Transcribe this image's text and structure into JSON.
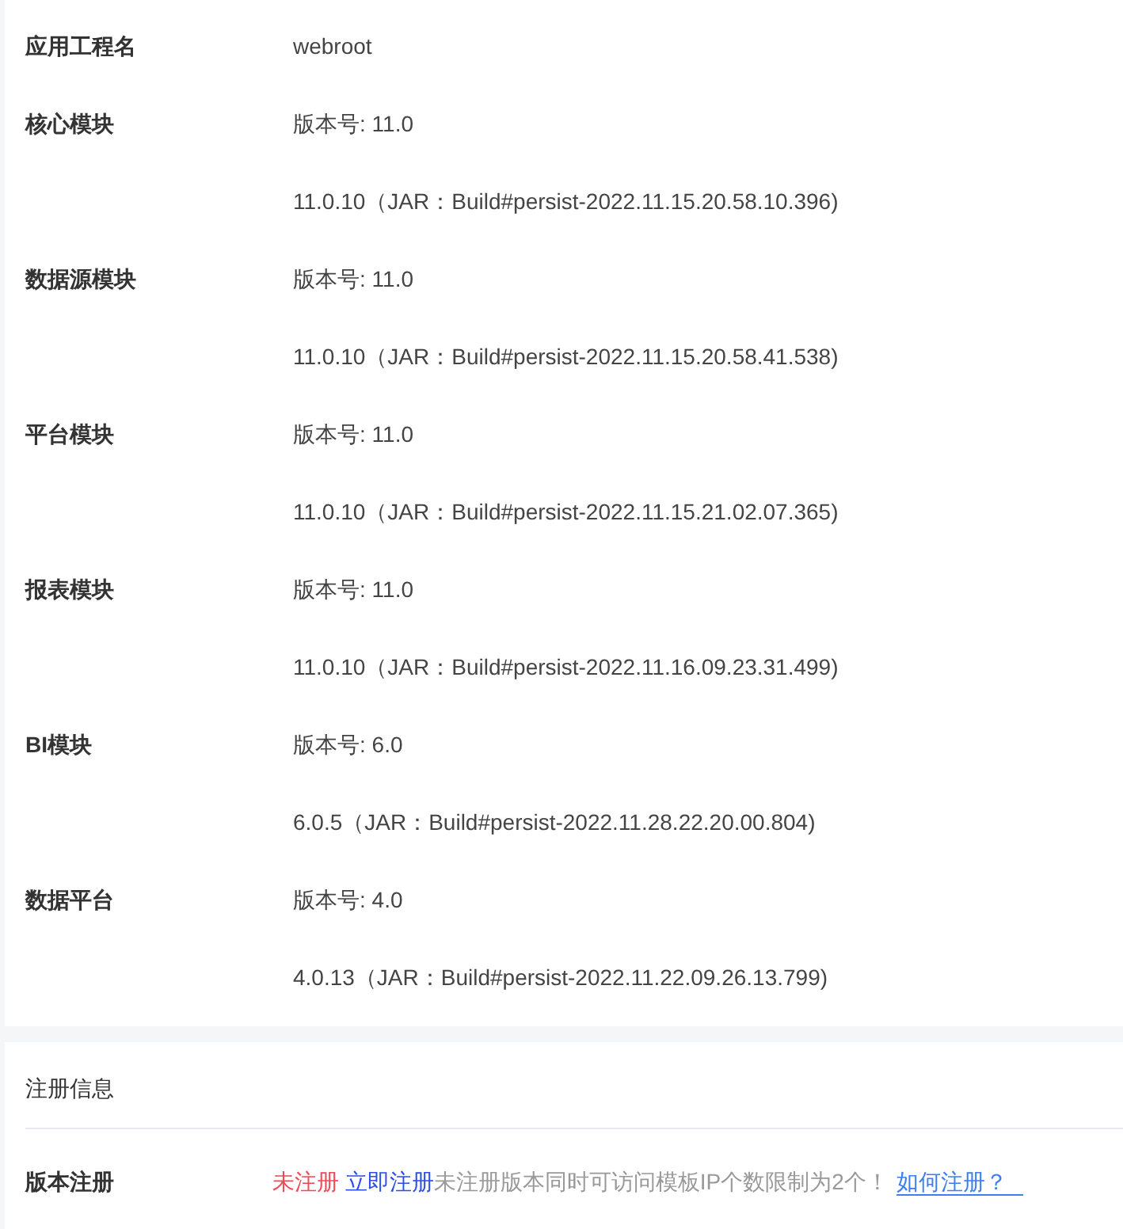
{
  "info_rows": [
    {
      "label": "应用工程名",
      "lines": [
        "webroot"
      ]
    },
    {
      "label": "核心模块",
      "lines": [
        "版本号: 11.0",
        "11.0.10（JAR：Build#persist-2022.11.15.20.58.10.396)"
      ]
    },
    {
      "label": "数据源模块",
      "lines": [
        "版本号: 11.0",
        "11.0.10（JAR：Build#persist-2022.11.15.20.58.41.538)"
      ]
    },
    {
      "label": "平台模块",
      "lines": [
        "版本号: 11.0",
        "11.0.10（JAR：Build#persist-2022.11.15.21.02.07.365)"
      ]
    },
    {
      "label": "报表模块",
      "lines": [
        "版本号: 11.0",
        "11.0.10（JAR：Build#persist-2022.11.16.09.23.31.499)"
      ]
    },
    {
      "label": "BI模块",
      "lines": [
        "版本号: 6.0",
        "6.0.5（JAR：Build#persist-2022.11.28.22.20.00.804)"
      ]
    },
    {
      "label": "数据平台",
      "lines": [
        "版本号: 4.0",
        "4.0.13（JAR：Build#persist-2022.11.22.09.26.13.799)"
      ]
    }
  ],
  "registration": {
    "title": "注册信息",
    "label": "版本注册",
    "status": "未注册",
    "register_link": "立即注册",
    "note": "未注册版本同时可访问模板IP个数限制为2个！",
    "help_link": "如何注册？"
  }
}
